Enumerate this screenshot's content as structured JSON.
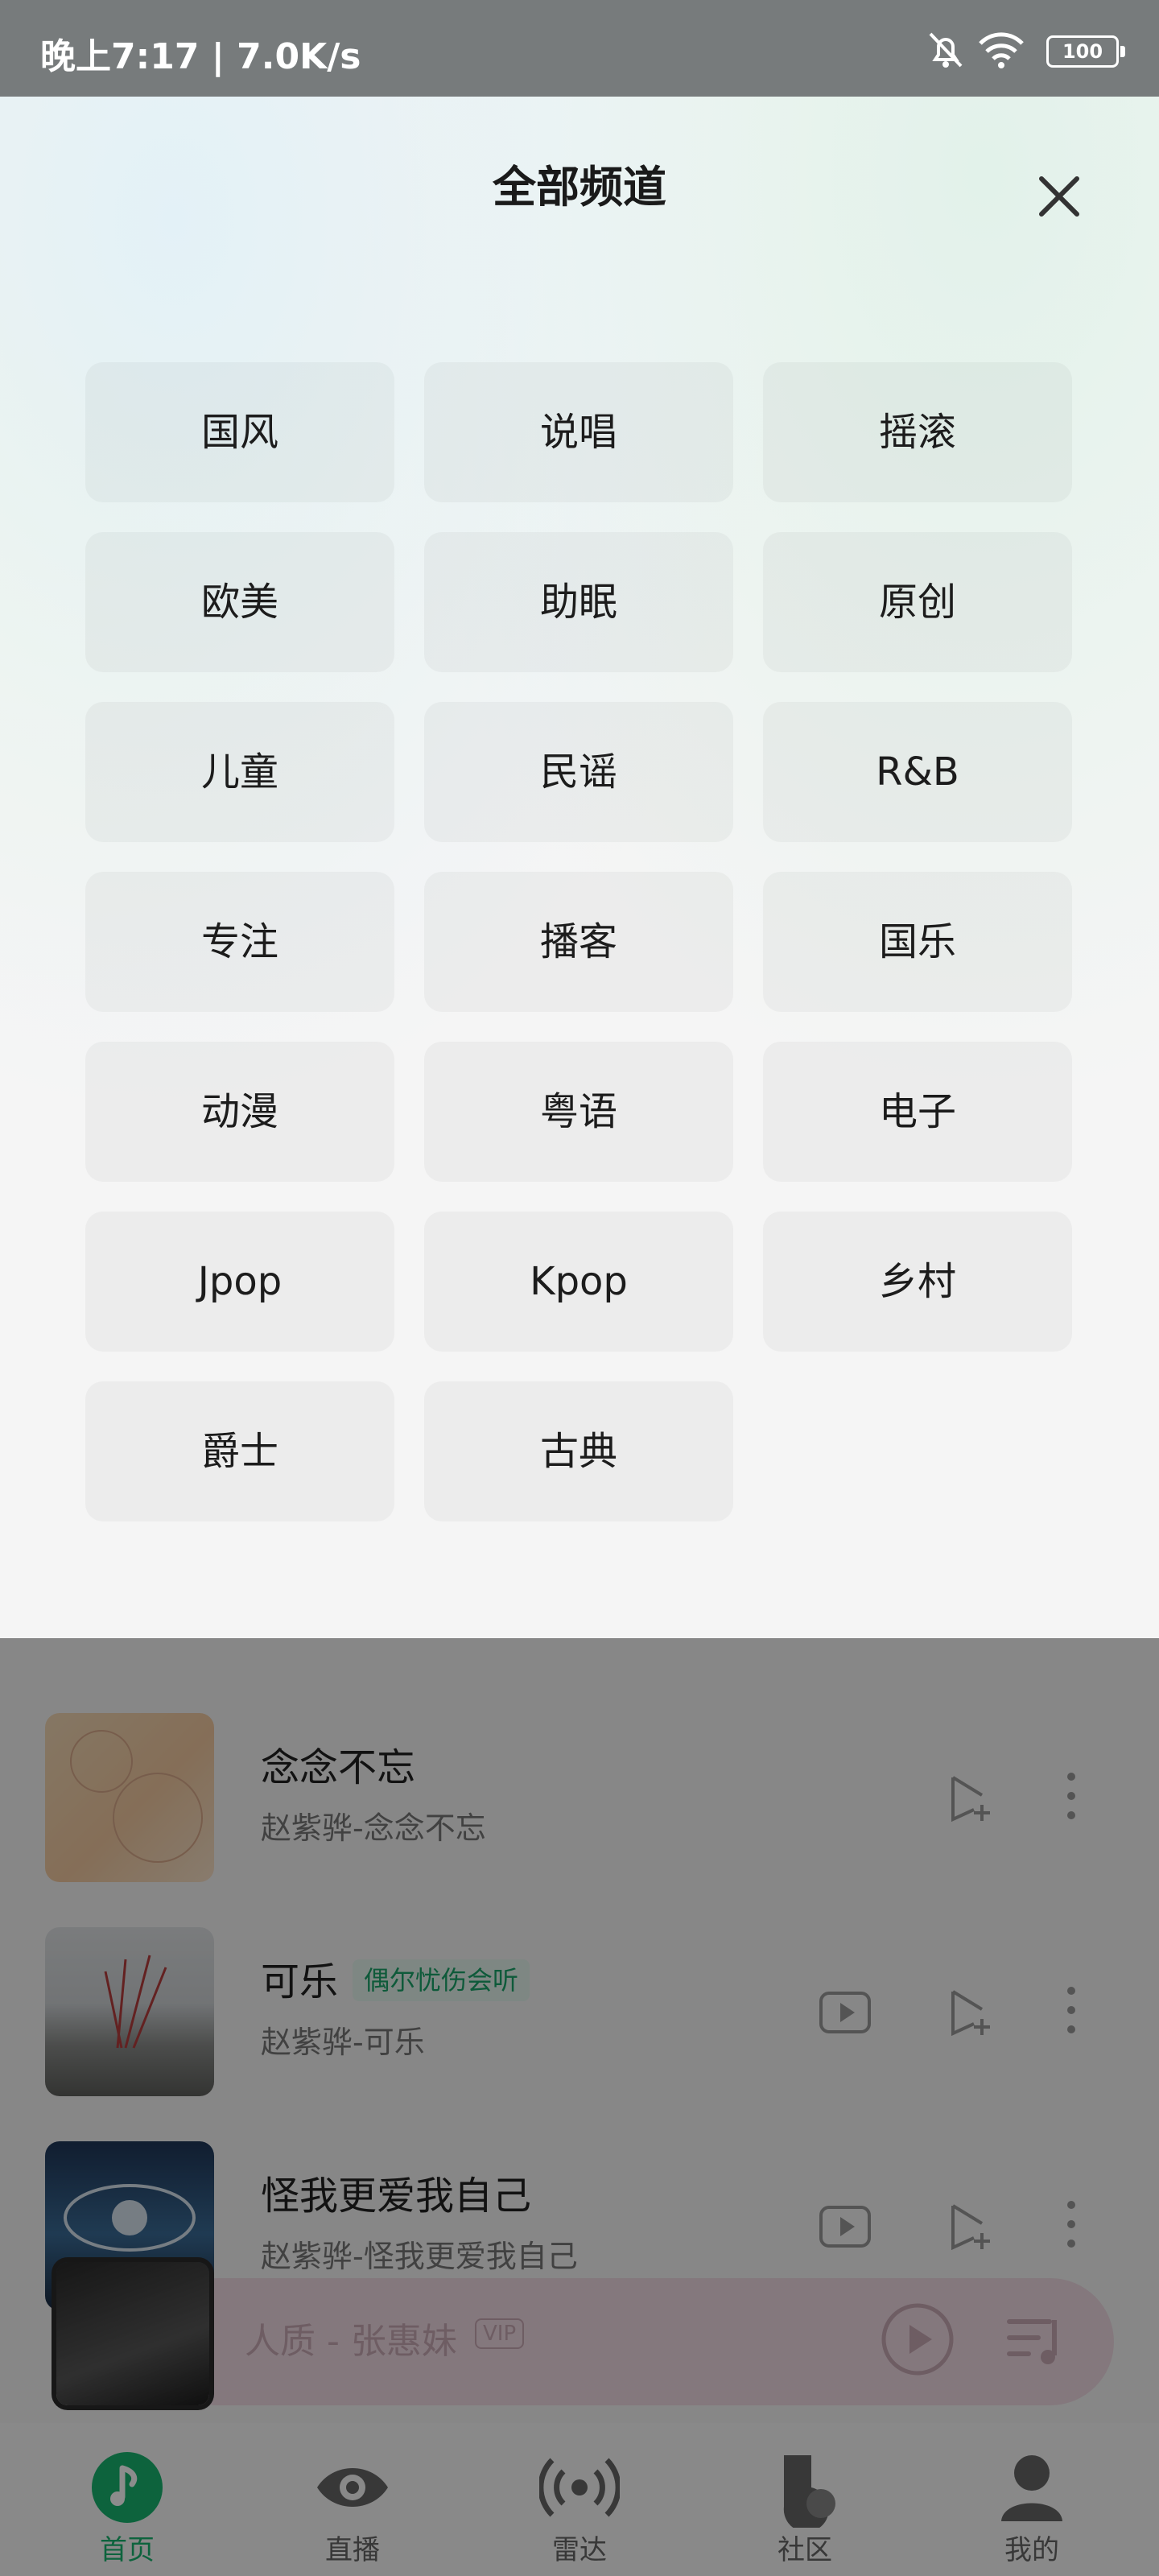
{
  "status_bar": {
    "time": "晚上7:17 | 7.0K/s",
    "battery": "100"
  },
  "sheet": {
    "title": "全部频道",
    "channels": [
      "国风",
      "说唱",
      "摇滚",
      "欧美",
      "助眠",
      "原创",
      "儿童",
      "民谣",
      "R&B",
      "专注",
      "播客",
      "国乐",
      "动漫",
      "粤语",
      "电子",
      "Jpop",
      "Kpop",
      "乡村",
      "爵士",
      "古典"
    ]
  },
  "songs": [
    {
      "title": "念念不忘",
      "subtitle": "赵紫骅-念念不忘",
      "tag": ""
    },
    {
      "title": "可乐",
      "subtitle": "赵紫骅-可乐",
      "tag": "偶尔忧伤会听"
    },
    {
      "title": "怪我更爱我自己",
      "subtitle": "赵紫骅-怪我更爱我自己",
      "tag": ""
    }
  ],
  "mini_player": {
    "title": "人质 - 张惠妹",
    "badge": "VIP"
  },
  "tabs": [
    {
      "label": "首页",
      "active": true
    },
    {
      "label": "直播"
    },
    {
      "label": "雷达"
    },
    {
      "label": "社区"
    },
    {
      "label": "我的"
    }
  ],
  "colors": {
    "accent": "#18b46f"
  }
}
